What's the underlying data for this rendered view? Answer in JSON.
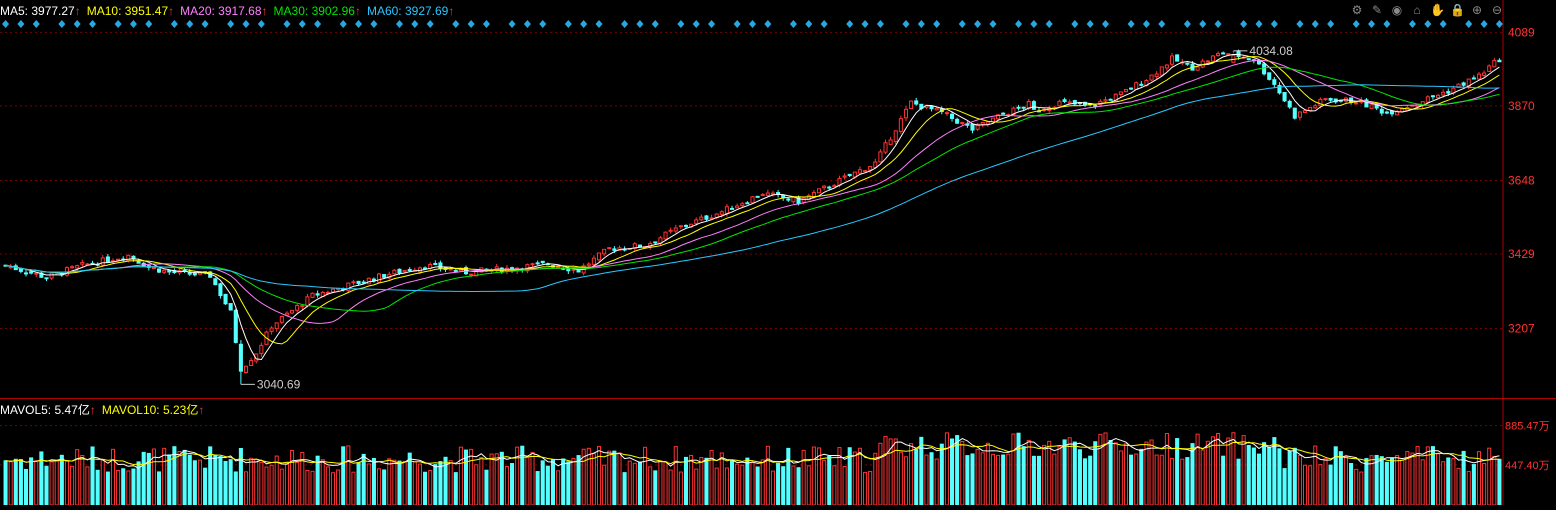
{
  "legend_main": [
    {
      "label": "MA5: ",
      "value": "3977.27",
      "arrow": "↑",
      "color": "#ffffff"
    },
    {
      "label": "MA10: ",
      "value": "3951.47",
      "arrow": "↑",
      "color": "#ffff00"
    },
    {
      "label": "MA20: ",
      "value": "3917.68",
      "arrow": "↑",
      "color": "#ff80ff"
    },
    {
      "label": "MA30: ",
      "value": "3902.96",
      "arrow": "↑",
      "color": "#00e600"
    },
    {
      "label": "MA60: ",
      "value": "3927.69",
      "arrow": "↑",
      "color": "#29c8ff"
    }
  ],
  "legend_vol": [
    {
      "label": "MAVOL5: ",
      "value": "5.47亿",
      "arrow": "↑",
      "color": "#ffffff"
    },
    {
      "label": "MAVOL10: ",
      "value": "5.23亿",
      "arrow": "↑",
      "color": "#ffff00"
    }
  ],
  "arrow_color": "#ff3232",
  "toolbar_icons": [
    "settings-icon",
    "pen-icon",
    "eye-icon",
    "shop-icon",
    "hand-icon",
    "lock-icon",
    "zoom-in-icon",
    "zoom-out-icon"
  ],
  "chart_data": {
    "type": "candlestick",
    "price_ticks": [
      "4089",
      "3870",
      "3648",
      "3429",
      "3207"
    ],
    "volume_ticks": [
      "885.47万",
      "447.40万"
    ],
    "price_range": [
      3000,
      4120
    ],
    "volume_range": [
      0,
      970
    ],
    "max_label": "4034.08",
    "min_label": "3040.69",
    "up_color": "#ff3232",
    "down_color": "#54ffff",
    "candle_count": 206,
    "ohlc_keypoints": [
      {
        "i": 0,
        "c": 3395
      },
      {
        "i": 8,
        "c": 3360
      },
      {
        "i": 15,
        "c": 3395
      },
      {
        "i": 24,
        "c": 3425
      },
      {
        "i": 28,
        "c": 3390
      },
      {
        "i": 32,
        "c": 3375
      },
      {
        "i": 40,
        "c": 3365
      },
      {
        "i": 44,
        "c": 3255
      },
      {
        "i": 46,
        "c": 3085
      },
      {
        "i": 49,
        "c": 3135
      },
      {
        "i": 52,
        "c": 3215
      },
      {
        "i": 60,
        "c": 3305
      },
      {
        "i": 68,
        "c": 3340
      },
      {
        "i": 75,
        "c": 3370
      },
      {
        "i": 82,
        "c": 3395
      },
      {
        "i": 90,
        "c": 3375
      },
      {
        "i": 98,
        "c": 3385
      },
      {
        "i": 106,
        "c": 3400
      },
      {
        "i": 112,
        "c": 3380
      },
      {
        "i": 118,
        "c": 3445
      },
      {
        "i": 125,
        "c": 3455
      },
      {
        "i": 132,
        "c": 3510
      },
      {
        "i": 140,
        "c": 3555
      },
      {
        "i": 148,
        "c": 3610
      },
      {
        "i": 155,
        "c": 3585
      },
      {
        "i": 162,
        "c": 3640
      },
      {
        "i": 170,
        "c": 3700
      },
      {
        "i": 177,
        "c": 3880
      },
      {
        "i": 183,
        "c": 3850
      },
      {
        "i": 189,
        "c": 3800
      },
      {
        "i": 195,
        "c": 3845
      },
      {
        "i": 200,
        "c": 3875
      }
    ],
    "ohlc_keypoints_b": [
      {
        "i": 0,
        "c": 3850
      },
      {
        "i": 6,
        "c": 3880
      },
      {
        "i": 12,
        "c": 3870
      },
      {
        "i": 18,
        "c": 3905
      },
      {
        "i": 24,
        "c": 3960
      },
      {
        "i": 28,
        "c": 4010
      },
      {
        "i": 32,
        "c": 3985
      },
      {
        "i": 38,
        "c": 4030
      },
      {
        "i": 44,
        "c": 4010
      },
      {
        "i": 48,
        "c": 3935
      },
      {
        "i": 52,
        "c": 3840
      },
      {
        "i": 58,
        "c": 3890
      },
      {
        "i": 64,
        "c": 3885
      },
      {
        "i": 70,
        "c": 3850
      },
      {
        "i": 76,
        "c": 3880
      },
      {
        "i": 82,
        "c": 3915
      },
      {
        "i": 88,
        "c": 3960
      },
      {
        "i": 92,
        "c": 4010
      }
    ]
  }
}
